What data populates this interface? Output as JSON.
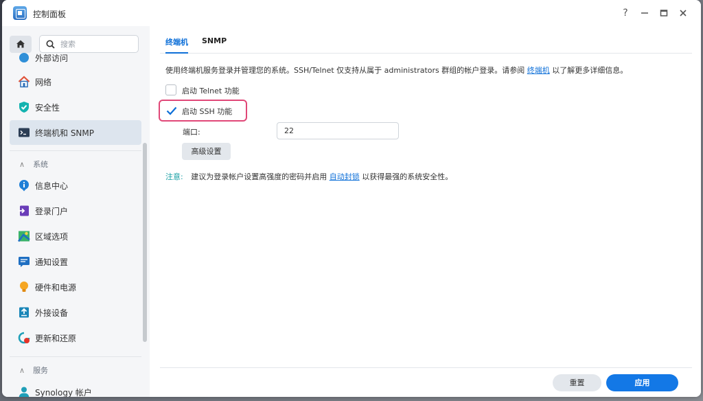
{
  "window": {
    "title": "控制面板",
    "controls": {
      "help": "?"
    }
  },
  "sidebar": {
    "search_placeholder": "搜索",
    "items": [
      {
        "label": "外部访问",
        "icon": "external-access-icon"
      },
      {
        "label": "网络",
        "icon": "network-house-icon"
      },
      {
        "label": "安全性",
        "icon": "shield-icon"
      },
      {
        "label": "终端机和 SNMP",
        "icon": "terminal-icon",
        "active": true
      }
    ],
    "sections": [
      {
        "title": "系统",
        "items": [
          {
            "label": "信息中心",
            "icon": "info-icon"
          },
          {
            "label": "登录门户",
            "icon": "login-portal-icon"
          },
          {
            "label": "区域选项",
            "icon": "map-icon"
          },
          {
            "label": "通知设置",
            "icon": "notification-icon"
          },
          {
            "label": "硬件和电源",
            "icon": "bulb-icon"
          },
          {
            "label": "外接设备",
            "icon": "upload-device-icon"
          },
          {
            "label": "更新和还原",
            "icon": "update-restore-icon"
          }
        ]
      },
      {
        "title": "服务",
        "items": [
          {
            "label": "Synology 帐户",
            "icon": "user-icon"
          }
        ]
      }
    ]
  },
  "main": {
    "tabs": [
      {
        "label": "终端机",
        "active": true
      },
      {
        "label": "SNMP",
        "active": false
      }
    ],
    "description": {
      "before": "使用终端机服务登录并管理您的系统。SSH/Telnet 仅支持从属于 administrators 群组的帐户登录。请参阅",
      "link": "终端机",
      "after": "以了解更多详细信息。"
    },
    "telnet": {
      "label": "启动 Telnet 功能",
      "checked": false
    },
    "ssh": {
      "label": "启动 SSH 功能",
      "checked": true
    },
    "port": {
      "label": "端口:",
      "value": "22"
    },
    "advanced_button": "高级设置",
    "note": {
      "label": "注意:",
      "before": "建议为登录帐户设置高强度的密码并启用",
      "link": "自动封锁",
      "after": "以获得最强的系统安全性。"
    },
    "buttons": {
      "reset": "重置",
      "apply": "应用"
    }
  },
  "colors": {
    "accent": "#0d6fd8",
    "apply_button": "#1378e6",
    "highlight_border": "#e04777",
    "note_label": "#19a0a5"
  }
}
